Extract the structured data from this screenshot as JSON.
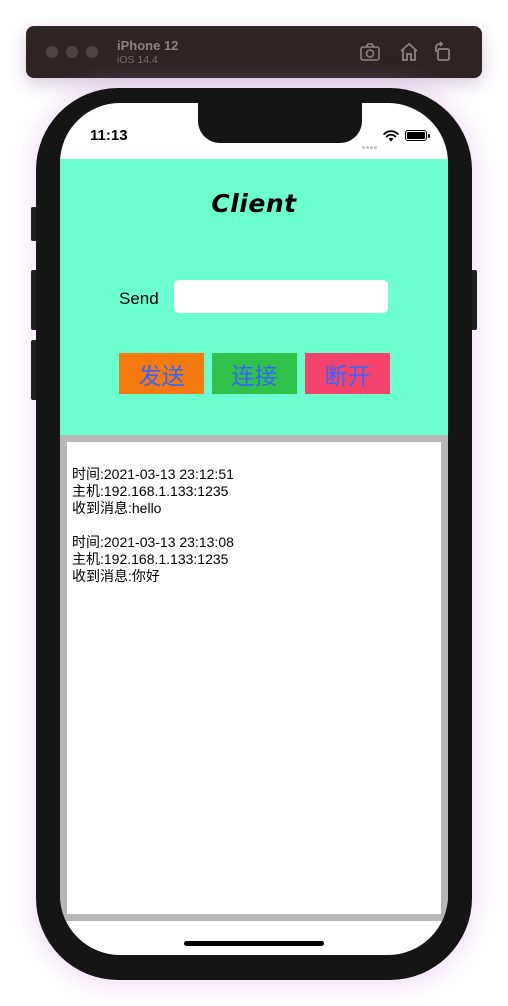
{
  "simulator": {
    "device_name": "iPhone 12",
    "os_version": "iOS 14.4",
    "toolbar_icons": [
      "screenshot-icon",
      "home-icon",
      "rotate-icon"
    ]
  },
  "status_bar": {
    "time": "11:13"
  },
  "app": {
    "title": "Client",
    "send_label": "Send",
    "send_input": {
      "value": "",
      "placeholder": ""
    },
    "buttons": {
      "send": "发送",
      "connect": "连接",
      "disconnect": "断开"
    },
    "log": [
      {
        "time_line": "时间:2021-03-13 23:12:51",
        "host_line": "主机:192.168.1.133:1235",
        "message_line": "收到消息:hello"
      },
      {
        "time_line": "时间:2021-03-13 23:13:08",
        "host_line": "主机:192.168.1.133:1235",
        "message_line": "收到消息:你好"
      }
    ]
  },
  "colors": {
    "header_bg": "#6bffcf",
    "send_button": "#f47a10",
    "connect_button": "#30c14a",
    "disconnect_button": "#f4436a",
    "button_text": "#3564ff",
    "log_border": "#b7b7b7"
  }
}
